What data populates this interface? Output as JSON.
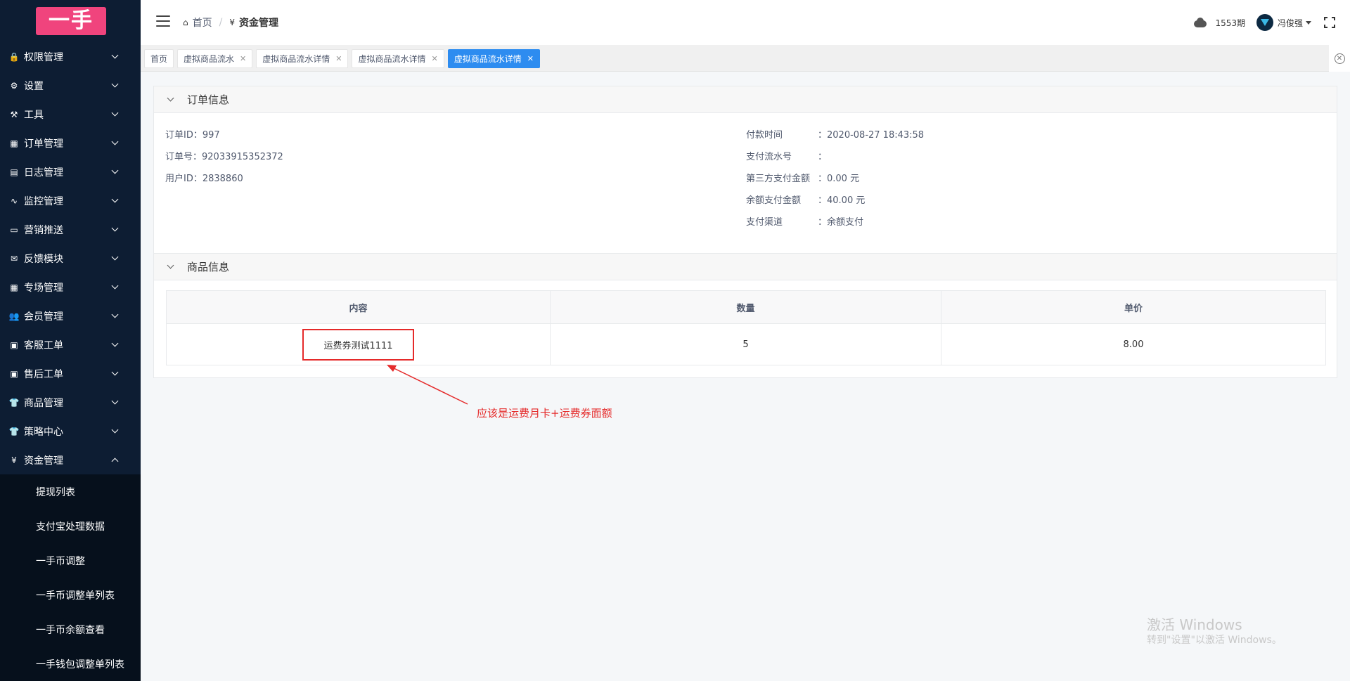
{
  "logo": {
    "text": "一手"
  },
  "sidebar": {
    "items": [
      {
        "label": "权限管理",
        "icon": "lock-icon",
        "glyph": "🔒"
      },
      {
        "label": "设置",
        "icon": "gear-icon",
        "glyph": "⚙"
      },
      {
        "label": "工具",
        "icon": "hammer-icon",
        "glyph": "⚒"
      },
      {
        "label": "订单管理",
        "icon": "list-icon",
        "glyph": "▦"
      },
      {
        "label": "日志管理",
        "icon": "document-icon",
        "glyph": "▤"
      },
      {
        "label": "监控管理",
        "icon": "pulse-icon",
        "glyph": "∿"
      },
      {
        "label": "营销推送",
        "icon": "card-icon",
        "glyph": "▭"
      },
      {
        "label": "反馈模块",
        "icon": "mail-icon",
        "glyph": "✉"
      },
      {
        "label": "专场管理",
        "icon": "grid-icon",
        "glyph": "▦"
      },
      {
        "label": "会员管理",
        "icon": "people-icon",
        "glyph": "👥"
      },
      {
        "label": "客服工单",
        "icon": "inbox-icon",
        "glyph": "▣"
      },
      {
        "label": "售后工单",
        "icon": "inbox-icon",
        "glyph": "▣"
      },
      {
        "label": "商品管理",
        "icon": "shirt-icon",
        "glyph": "👕"
      },
      {
        "label": "策略中心",
        "icon": "shirt-icon",
        "glyph": "👕"
      },
      {
        "label": "资金管理",
        "icon": "yen-icon",
        "glyph": "¥"
      }
    ],
    "submenu": [
      {
        "label": "提现列表"
      },
      {
        "label": "支付宝处理数据"
      },
      {
        "label": "一手币调整"
      },
      {
        "label": "一手币调整单列表"
      },
      {
        "label": "一手币余额查看"
      },
      {
        "label": "一手钱包调整单列表"
      }
    ]
  },
  "header": {
    "breadcrumb": {
      "home": "首页",
      "current": "资金管理",
      "separator": "/"
    },
    "period": "1553期",
    "username": "冯俊强"
  },
  "tabs": [
    {
      "label": "首页",
      "closable": false
    },
    {
      "label": "虚拟商品流水",
      "closable": true
    },
    {
      "label": "虚拟商品流水详情",
      "closable": true
    },
    {
      "label": "虚拟商品流水详情",
      "closable": true
    },
    {
      "label": "虚拟商品流水详情",
      "closable": true,
      "active": true
    }
  ],
  "order_section": {
    "title": "订单信息",
    "left": [
      {
        "text": "订单ID：997"
      },
      {
        "text": "订单号：92033915352372"
      },
      {
        "text": "用户ID：2838860"
      }
    ],
    "right": [
      {
        "label": "付款时间",
        "value": "：2020-08-27 18:43:58"
      },
      {
        "label": "支付流水号",
        "value": "："
      },
      {
        "label": "第三方支付金额",
        "value": "：0.00 元"
      },
      {
        "label": "余额支付金额",
        "value": "：40.00 元"
      },
      {
        "label": "支付渠道",
        "value": "：余额支付"
      }
    ]
  },
  "goods_section": {
    "title": "商品信息",
    "columns": [
      "内容",
      "数量",
      "单价"
    ],
    "rows": [
      {
        "content": "运费券测试1111",
        "quantity": "5",
        "price": "8.00"
      }
    ]
  },
  "annotation": {
    "text": "应该是运费月卡+运费券面额",
    "color": "#e52a2a"
  },
  "watermark": {
    "line1": "激活 Windows",
    "line2": "转到\"设置\"以激活 Windows。"
  },
  "colors": {
    "sidebar_bg": "#0d1d33",
    "logo_bg": "#f0447d",
    "active_tab": "#2d8cf0"
  }
}
